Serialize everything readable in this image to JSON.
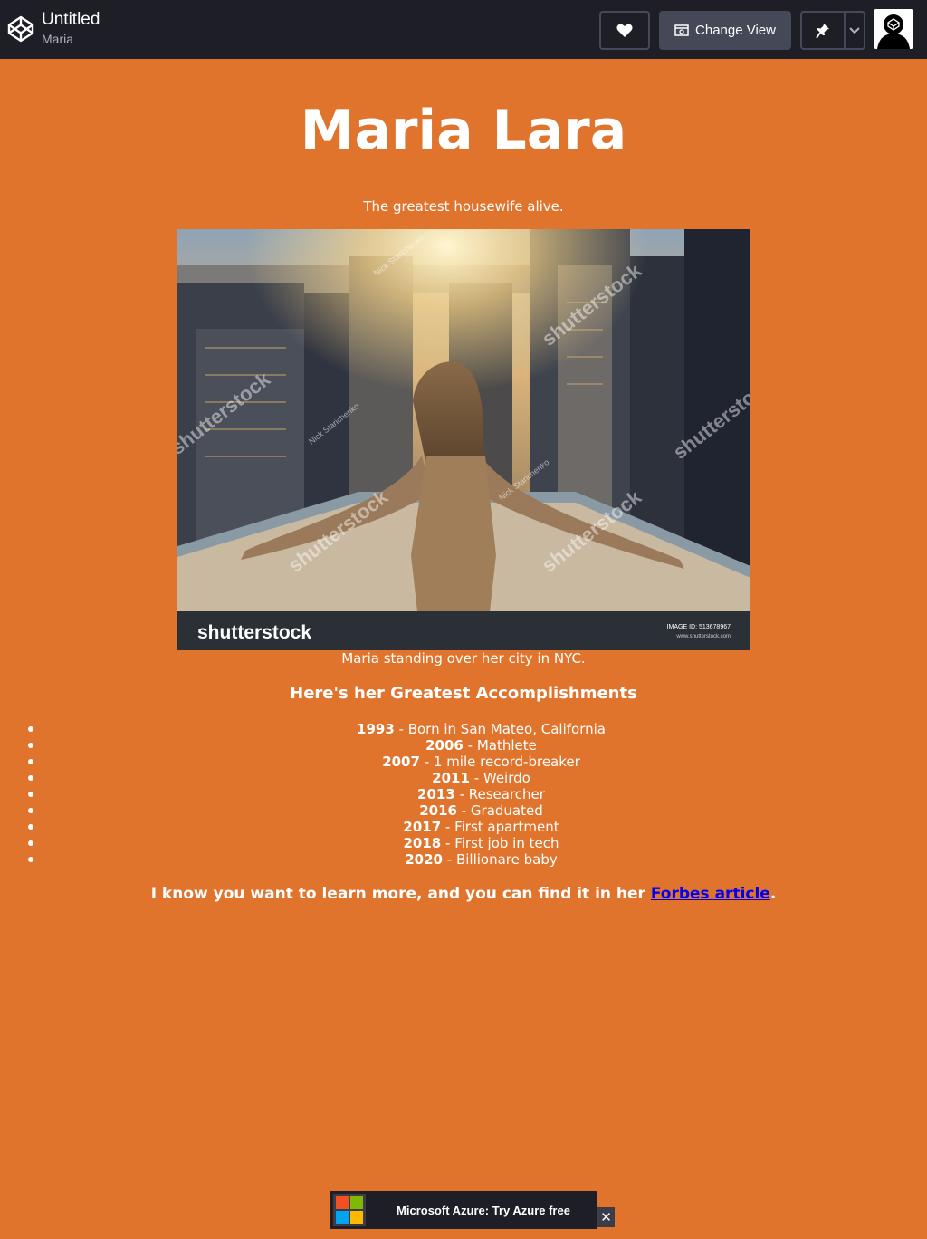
{
  "header": {
    "title": "Untitled",
    "author": "Maria",
    "change_view_label": "Change View"
  },
  "page": {
    "name": "Maria Lara",
    "tagline": "The greatest housewife alive.",
    "image": {
      "watermark_brand": "shutterstock",
      "watermark_id": "IMAGE ID: 513678967",
      "watermark_site": "www.shutterstock.com",
      "photographer": "Nick Starichenko"
    },
    "caption": "Maria standing over her city in NYC.",
    "accomplishments_heading": "Here's her Greatest Accomplishments",
    "accomplishments": [
      {
        "year": "1993",
        "text": " - Born in San Mateo, California"
      },
      {
        "year": "2006",
        "text": " - Mathlete"
      },
      {
        "year": "2007",
        "text": " - 1 mile record-breaker"
      },
      {
        "year": "2011",
        "text": " - Weirdo"
      },
      {
        "year": "2013",
        "text": " - Researcher"
      },
      {
        "year": "2016",
        "text": " - Graduated"
      },
      {
        "year": "2017",
        "text": " - First apartment"
      },
      {
        "year": "2018",
        "text": " - First job in tech"
      },
      {
        "year": "2020",
        "text": " - Billionare baby"
      }
    ],
    "outro_text": "I know you want to learn more, and you can find it in her ",
    "outro_link": "Forbes article",
    "outro_end": "."
  },
  "ad": {
    "text": "Microsoft Azure: Try Azure free",
    "close": "✕"
  },
  "colors": {
    "background": "#e0742d",
    "topbar": "#1e1f26",
    "link": "#0000ee"
  }
}
